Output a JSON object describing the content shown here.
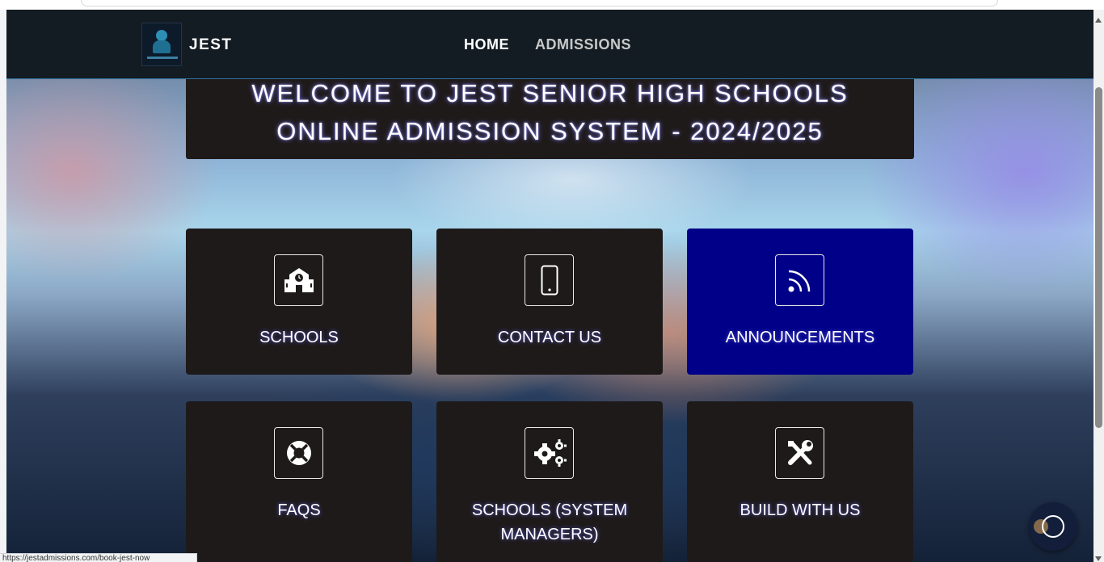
{
  "navbar": {
    "brand": "JEST",
    "links": [
      {
        "label": "HOME",
        "active": true
      },
      {
        "label": "ADMISSIONS",
        "active": false
      }
    ]
  },
  "welcome": {
    "line1": "WELCOME TO JEST SENIOR HIGH SCHOOLS",
    "line2": "ONLINE ADMISSION SYSTEM - 2024/2025"
  },
  "cards": [
    {
      "label": "SCHOOLS",
      "icon": "school-icon",
      "active": false
    },
    {
      "label": "CONTACT US",
      "icon": "mobile-phone-icon",
      "active": false
    },
    {
      "label": "ANNOUNCEMENTS",
      "icon": "rss-feed-icon",
      "active": true
    },
    {
      "label": "FAQS",
      "icon": "life-ring-icon",
      "active": false
    },
    {
      "label": "SCHOOLS (SYSTEM MANAGERS)",
      "icon": "cogs-icon",
      "active": false
    },
    {
      "label": "BUILD WITH US",
      "icon": "tools-icon",
      "active": false
    }
  ],
  "status_bar": {
    "url": "https://jestadmissions.com/book-jest-now"
  },
  "colors": {
    "navbar_bg": "#131c23",
    "card_bg": "#1e1a1a",
    "card_active_bg": "#000088",
    "text": "#ffffff"
  }
}
